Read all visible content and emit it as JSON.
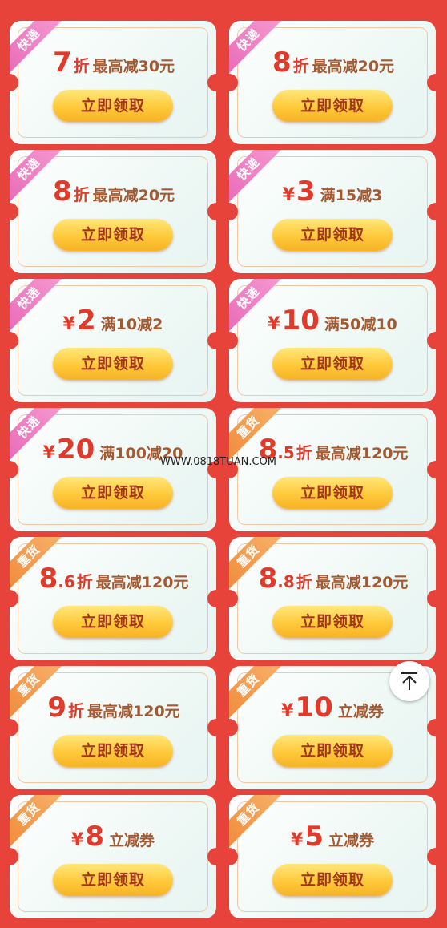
{
  "button_label": "立即领取",
  "ribbons": {
    "kd": "快递",
    "zh": "重货"
  },
  "watermark": "WWW.0818TUAN.COM",
  "colors": {
    "background": "#e8433b",
    "accent": "#e23a2a",
    "button": "#ffc93a"
  },
  "coupons": [
    {
      "tag": "快递",
      "sym": "",
      "big": "7",
      "dec": "",
      "unit": "折",
      "desc": "最高减30元"
    },
    {
      "tag": "快递",
      "sym": "",
      "big": "8",
      "dec": "",
      "unit": "折",
      "desc": "最高减20元"
    },
    {
      "tag": "快递",
      "sym": "",
      "big": "8",
      "dec": "",
      "unit": "折",
      "desc": "最高减20元"
    },
    {
      "tag": "快递",
      "sym": "¥",
      "big": "3",
      "dec": "",
      "unit": "",
      "desc": "满15减3"
    },
    {
      "tag": "快递",
      "sym": "¥",
      "big": "2",
      "dec": "",
      "unit": "",
      "desc": "满10减2"
    },
    {
      "tag": "快递",
      "sym": "¥",
      "big": "10",
      "dec": "",
      "unit": "",
      "desc": "满50减10"
    },
    {
      "tag": "快递",
      "sym": "¥",
      "big": "20",
      "dec": "",
      "unit": "",
      "desc": "满100减20"
    },
    {
      "tag": "重货",
      "sym": "",
      "big": "8",
      "dec": ".5",
      "unit": "折",
      "desc": "最高减120元"
    },
    {
      "tag": "重货",
      "sym": "",
      "big": "8",
      "dec": ".6",
      "unit": "折",
      "desc": "最高减120元"
    },
    {
      "tag": "重货",
      "sym": "",
      "big": "8",
      "dec": ".8",
      "unit": "折",
      "desc": "最高减120元"
    },
    {
      "tag": "重货",
      "sym": "",
      "big": "9",
      "dec": "",
      "unit": "折",
      "desc": "最高减120元"
    },
    {
      "tag": "重货",
      "sym": "¥",
      "big": "10",
      "dec": "",
      "unit": "",
      "desc": "立减券"
    },
    {
      "tag": "重货",
      "sym": "¥",
      "big": "8",
      "dec": "",
      "unit": "",
      "desc": "立减券"
    },
    {
      "tag": "重货",
      "sym": "¥",
      "big": "5",
      "dec": "",
      "unit": "",
      "desc": "立减券"
    }
  ]
}
